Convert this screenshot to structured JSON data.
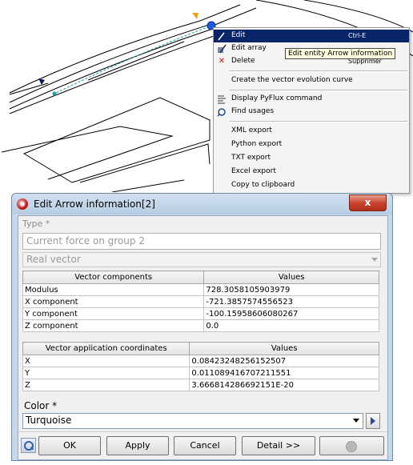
{
  "context_menu": {
    "items": [
      {
        "label": "Edit",
        "shortcut": "Ctrl-E",
        "icon": "pencil-icon",
        "selected": true
      },
      {
        "label": "Edit array",
        "shortcut": "Ctrl-E",
        "icon": "edit-array-icon"
      },
      {
        "label": "Delete",
        "shortcut": "Supprimer",
        "icon": "delete-x-icon"
      },
      {
        "label": "Create the vector evolution curve"
      },
      {
        "label": "Display PyFlux command",
        "icon": "pyflux-icon"
      },
      {
        "label": "Find usages",
        "icon": "find-usages-icon"
      },
      {
        "label": "XML export"
      },
      {
        "label": "Python export"
      },
      {
        "label": "TXT export"
      },
      {
        "label": "Excel export"
      },
      {
        "label": "Copy to clipboard"
      }
    ],
    "tooltip": "Edit entity Arrow information"
  },
  "dialog": {
    "title": "Edit Arrow information[2]",
    "close_label": "x",
    "type_label": "Type *",
    "type_value": "Current force on group 2",
    "kind_value": "Real vector",
    "components_table": {
      "headers": [
        "Vector components",
        "Values"
      ],
      "rows": [
        [
          "Modulus",
          "728.3058105903979"
        ],
        [
          "X component",
          "-721.3857574556523"
        ],
        [
          "Y component",
          "-100.15958606080267"
        ],
        [
          "Z component",
          "0.0"
        ]
      ]
    },
    "coords_table": {
      "headers": [
        "Vector application coordinates",
        "Values"
      ],
      "rows": [
        [
          "X",
          "0.08423248256152507"
        ],
        [
          "Y",
          "0.011089416707211551"
        ],
        [
          "Z",
          "3.666814286692151E-20"
        ]
      ]
    },
    "color_label": "Color *",
    "color_value": "Turquoise",
    "buttons": {
      "ok": "OK",
      "apply": "Apply",
      "cancel": "Cancel",
      "detail": "Detail >>"
    }
  },
  "colors": {
    "menu_highlight": "#0a246a",
    "dialog_frame": "#c5d7ea",
    "close_button": "#c9452f",
    "canvas_line": "#000000",
    "selection_marker": "#1e5adc",
    "arrow_orange": "#f0a020",
    "arrow_navy": "#0a1a5c"
  }
}
